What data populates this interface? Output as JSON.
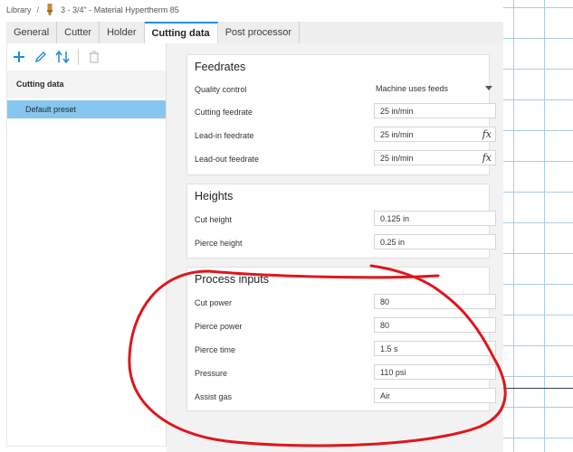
{
  "breadcrumb": {
    "library": "Library",
    "separator": "/",
    "item": "3 - 3/4\" - Material Hypertherm 85"
  },
  "tabs": [
    {
      "label": "General"
    },
    {
      "label": "Cutter"
    },
    {
      "label": "Holder"
    },
    {
      "label": "Cutting data"
    },
    {
      "label": "Post processor"
    }
  ],
  "left_panel": {
    "section_title": "Cutting data",
    "preset": "Default preset"
  },
  "feedrates": {
    "title": "Feedrates",
    "quality_control_label": "Quality control",
    "quality_control_value": "Machine uses feeds",
    "cutting_feedrate_label": "Cutting feedrate",
    "cutting_feedrate_value": "25 in/min",
    "leadin_feedrate_label": "Lead-in feedrate",
    "leadin_feedrate_value": "25 in/min",
    "leadout_feedrate_label": "Lead-out feedrate",
    "leadout_feedrate_value": "25 in/min",
    "fx": "fx"
  },
  "heights": {
    "title": "Heights",
    "cut_height_label": "Cut height",
    "cut_height_value": "0.125 in",
    "pierce_height_label": "Pierce height",
    "pierce_height_value": "0.25 in"
  },
  "process_inputs": {
    "title": "Process inputs",
    "cut_power_label": "Cut power",
    "cut_power_value": "80",
    "pierce_power_label": "Pierce power",
    "pierce_power_value": "80",
    "pierce_time_label": "Pierce time",
    "pierce_time_value": "1.5 s",
    "pressure_label": "Pressure",
    "pressure_value": "110 psi",
    "assist_gas_label": "Assist gas",
    "assist_gas_value": "Air"
  },
  "colors": {
    "accent": "#1e8ed6",
    "selection": "#87c6ee",
    "annotation": "#e0161b"
  }
}
